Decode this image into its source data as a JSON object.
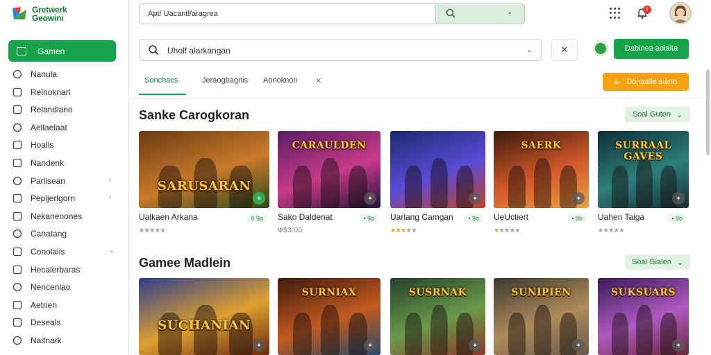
{
  "app": {
    "logo_line1": "Gretwerk",
    "logo_line2": "Geowini"
  },
  "topbar": {
    "search_text": "Apt/ Uacantl/aragrea",
    "notification_count": "1"
  },
  "sidebar": {
    "active_label": "Gamen",
    "items": [
      {
        "label": "Nanula",
        "icon": "refresh-icon",
        "chev": ""
      },
      {
        "label": "Relnoknarl",
        "icon": "user-icon",
        "chev": ""
      },
      {
        "label": "Relandlano",
        "icon": "lock-icon",
        "chev": ""
      },
      {
        "label": "Aellaelaat",
        "icon": "upload-icon",
        "chev": ""
      },
      {
        "label": "Hoalls",
        "icon": "document-icon",
        "chev": ""
      },
      {
        "label": "Nandenk",
        "icon": "calendar-icon",
        "chev": ""
      },
      {
        "label": "Parlisean",
        "icon": "folder-icon",
        "chev": "›"
      },
      {
        "label": "Pepljerlgorn",
        "icon": "chart-icon",
        "chev": "›"
      },
      {
        "label": "Nekanenones",
        "icon": "camera-icon",
        "chev": ""
      },
      {
        "label": "Canatang",
        "icon": "grid-icon",
        "chev": ""
      },
      {
        "label": "Conolaiis",
        "icon": "list-icon",
        "chev": "⌄"
      },
      {
        "label": "Hecalerbaras",
        "icon": "settings-icon",
        "chev": ""
      },
      {
        "label": "Nencenlao",
        "icon": "tag-icon",
        "chev": ""
      },
      {
        "label": "Aetrien",
        "icon": "pen-icon",
        "chev": ""
      },
      {
        "label": "Deseals",
        "icon": "search-icon",
        "chev": ""
      },
      {
        "label": "Naitnark",
        "icon": "checkbox-icon",
        "chev": ""
      }
    ]
  },
  "toolbar": {
    "filter_text": "Uholf alarkangan",
    "clear_symbol": "✕",
    "primary_button": "Dabinea aolaita",
    "orange_button": "Donaalle slann"
  },
  "tabs": [
    {
      "label": "Sonchacs",
      "active": true
    },
    {
      "label": "Jeraogbagnis",
      "active": false
    },
    {
      "label": "Aonoknon",
      "active": false
    }
  ],
  "sections": [
    {
      "title": "Sanke Carogkoran",
      "sort_label": "Soal Guten",
      "cards": [
        {
          "name": "Ualkaen Arkana",
          "price": "0 9o",
          "stars": 0,
          "sub": "",
          "thumb_title": "SARUSARAN",
          "badge_green": true
        },
        {
          "name": "Sako Daldenat",
          "price": "• 9o",
          "stars": 0,
          "sub": "Ф$3:00",
          "thumb_title": "CARAULDEN",
          "badge_green": false
        },
        {
          "name": "Uarlang Camgan",
          "price": "• 9o",
          "stars": 3,
          "sub": "",
          "thumb_title": "",
          "badge_green": false
        },
        {
          "name": "UeUctiert",
          "price": "• 9o",
          "stars": 1,
          "sub": "",
          "thumb_title": "SAERK",
          "badge_green": false
        },
        {
          "name": "Uahen Taiga",
          "price": "• 9o",
          "stars": 0,
          "sub": "",
          "thumb_title": "SURRAAL GAVES",
          "badge_green": false
        }
      ]
    },
    {
      "title": "Gamee Madlein",
      "sort_label": "Soal Gialen",
      "cards": [
        {
          "thumb_title": "SUCHANIAN"
        },
        {
          "thumb_title": "SURNIAX"
        },
        {
          "thumb_title": "SUSRNAK"
        },
        {
          "thumb_title": "SUNIPIEN"
        },
        {
          "thumb_title": "SUKSUARS"
        }
      ]
    }
  ],
  "colors": {
    "accent": "#17a34a",
    "orange": "#f6a312",
    "star": "#e3a21a"
  }
}
